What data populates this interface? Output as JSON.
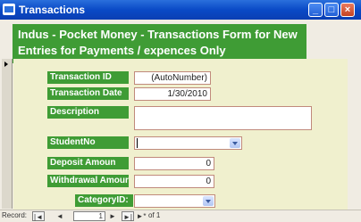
{
  "window": {
    "title": "Transactions"
  },
  "form": {
    "header": "Indus - Pocket Money - Transactions  Form for New Entries for Payments / expences Only",
    "fields": {
      "transaction_id": {
        "label": "Transaction ID",
        "value": "(AutoNumber)"
      },
      "transaction_date": {
        "label": "Transaction Date",
        "value": "1/30/2010"
      },
      "description": {
        "label": "Description",
        "value": ""
      },
      "student_no": {
        "label": "StudentNo",
        "value": ""
      },
      "deposit_amount": {
        "label": "Deposit Amoun",
        "value": "0"
      },
      "withdrawal_amount": {
        "label": "Withdrawal Amour",
        "value": "0"
      },
      "category_id": {
        "label": "CategoryID:",
        "value": ""
      }
    }
  },
  "navigation": {
    "label": "Record:",
    "first": "|◄",
    "prev": "◄",
    "current": "1",
    "next": "►",
    "last": "►|",
    "new": "►*",
    "of_text": "of 1"
  }
}
